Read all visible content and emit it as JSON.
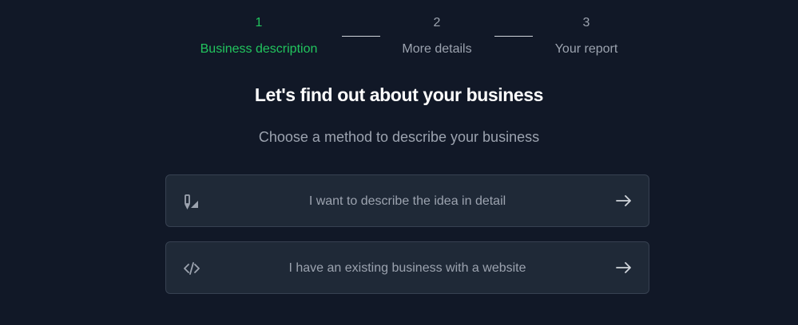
{
  "stepper": {
    "steps": [
      {
        "number": "1",
        "label": "Business description"
      },
      {
        "number": "2",
        "label": "More details"
      },
      {
        "number": "3",
        "label": "Your report"
      }
    ],
    "active_step": 1
  },
  "heading": {
    "title": "Let's find out about your business",
    "subtitle": "Choose a method to describe your business"
  },
  "options": [
    {
      "icon": "pen-ruler-icon",
      "label": "I want to describe the idea in detail",
      "arrow": "arrow-right-icon"
    },
    {
      "icon": "code-icon",
      "label": "I have an existing business with a website",
      "arrow": "arrow-right-icon"
    }
  ],
  "colors": {
    "background": "#111827",
    "active_step": "#22c55e",
    "card_background": "#1f2937",
    "card_border": "#374151",
    "muted_text": "#9ca3af",
    "title_text": "#ffffff"
  }
}
